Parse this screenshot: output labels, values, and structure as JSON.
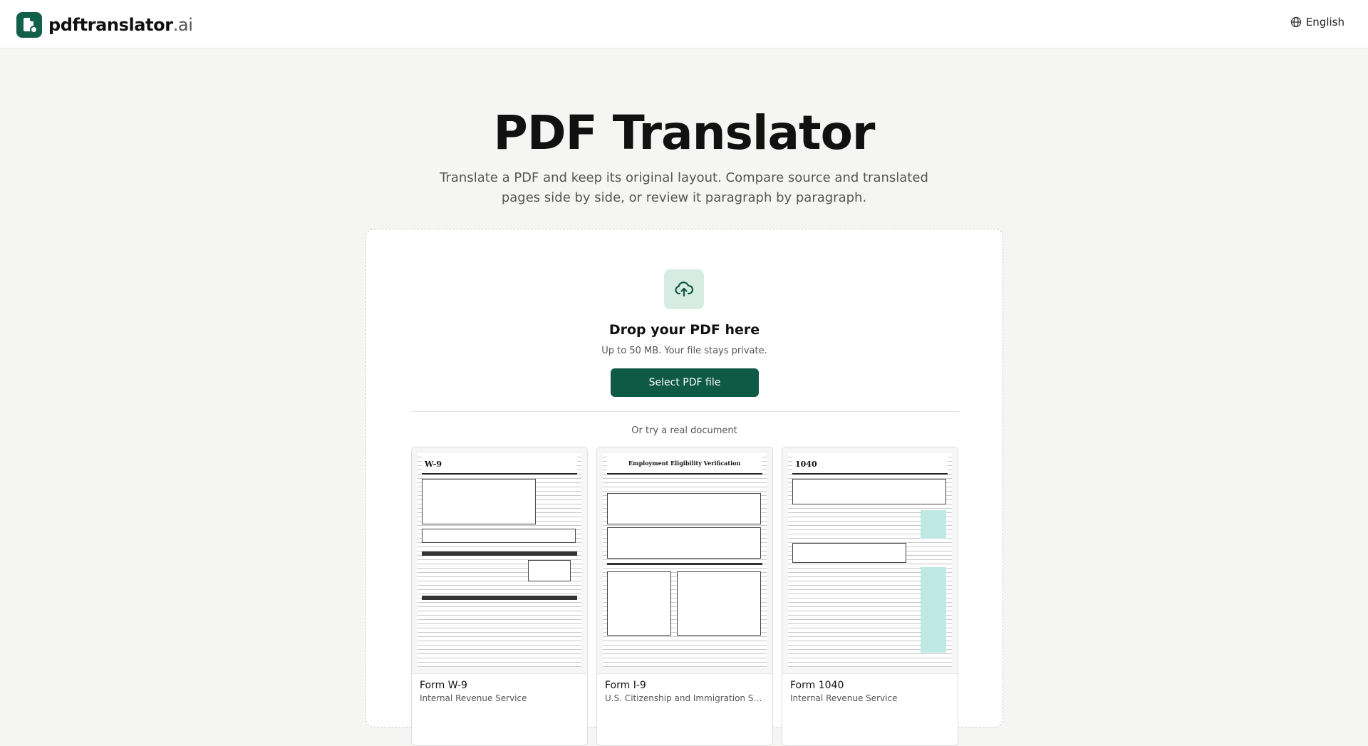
{
  "header": {
    "logo_text": "pdftranslator",
    "logo_tld": ".ai",
    "language_label": "English"
  },
  "hero": {
    "title": "PDF Translator",
    "subtitle": "Translate a PDF and keep its original layout. Compare source and translated pages side by side, or review it paragraph by paragraph."
  },
  "dropzone": {
    "title": "Drop your PDF here",
    "note": "Up to 50 MB. Your file stays private.",
    "button_label": "Select PDF file",
    "try_label": "Or try a real document"
  },
  "samples": [
    {
      "name": "Form W-9",
      "org": "Internal Revenue Service",
      "thumb_title": "W-9"
    },
    {
      "name": "Form I-9",
      "org": "U.S. Citizenship and Immigration Services",
      "thumb_title": "Employment Eligibility Verification"
    },
    {
      "name": "Form 1040",
      "org": "Internal Revenue Service",
      "thumb_title": "1040"
    }
  ],
  "colors": {
    "brand": "#12604a",
    "button": "#0f5a44",
    "icon_bg": "#d6ebe2"
  }
}
